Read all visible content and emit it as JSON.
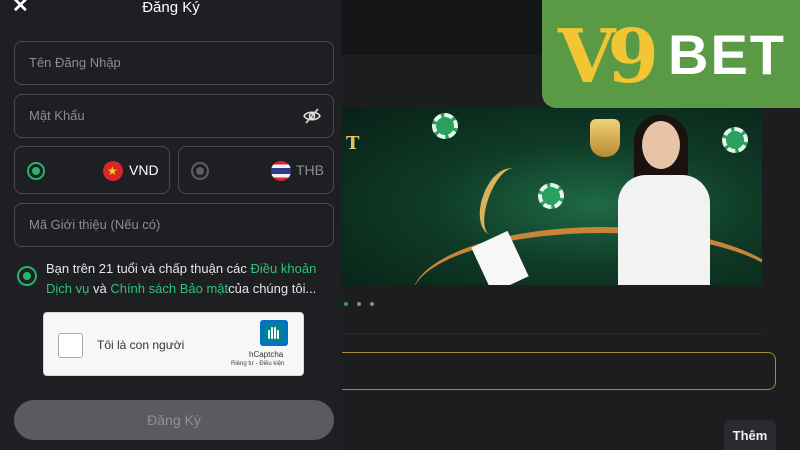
{
  "modal": {
    "title": "Đăng Ký",
    "username_placeholder": "Tên Đăng Nhập",
    "password_placeholder": "Mật Khẩu",
    "currencies": [
      {
        "label": "VND",
        "selected": true,
        "flag": "vietnam-flag-icon"
      },
      {
        "label": "THB",
        "selected": false,
        "flag": "thailand-flag-icon"
      }
    ],
    "referral_placeholder": "Mã Giới thiệu (Nếu có)",
    "terms": {
      "prefix": "Bạn trên 21 tuổi và chấp thuận các ",
      "link_terms": "Điều khoản Dịch vụ",
      "middle": " và ",
      "link_privacy": "Chính sách Bảo mật",
      "suffix": "của chúng tôi..."
    },
    "captcha": {
      "label": "Tôi là con người",
      "brand": "hCaptcha",
      "links": "Riêng tư - Điều kiện"
    },
    "submit_label": "Đăng Ký"
  },
  "logo": {
    "prefix": "V9",
    "suffix": "BET"
  },
  "background": {
    "more_button": "Thêm"
  },
  "colors": {
    "accent": "#25b56a",
    "logo_bg": "#5a9a44",
    "logo_gold": "#f2c533",
    "modal_bg": "#1e1f22"
  },
  "icons": [
    "close-icon",
    "eye-slash-icon",
    "hcaptcha-icon"
  ]
}
